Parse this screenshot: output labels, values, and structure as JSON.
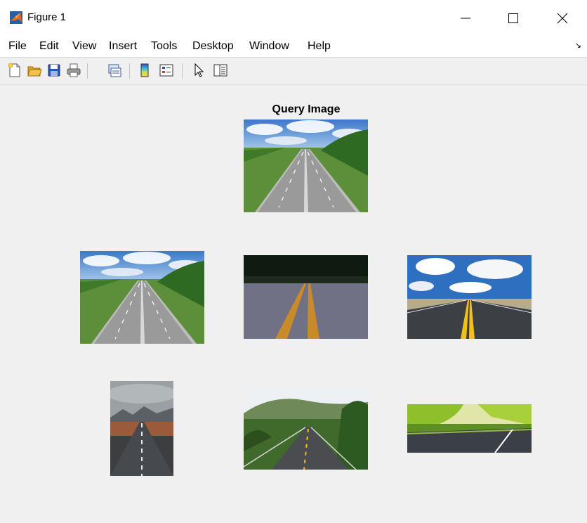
{
  "window": {
    "title": "Figure 1",
    "minimize_icon": "minimize-icon",
    "maximize_icon": "maximize-icon",
    "close_icon": "close-icon"
  },
  "menu": {
    "items": [
      "File",
      "Edit",
      "View",
      "Insert",
      "Tools",
      "Desktop",
      "Window",
      "Help"
    ]
  },
  "toolbar": {
    "icons": [
      "new-figure-icon",
      "open-file-icon",
      "save-icon",
      "print-icon",
      "link-plot-icon",
      "colorbar-icon",
      "legend-icon",
      "select-arrow-icon",
      "property-inspector-icon"
    ]
  },
  "figure": {
    "query_title": "Query Image",
    "images": [
      {
        "name": "query-image",
        "scene": "highway with grass and trees under cloudy blue sky"
      },
      {
        "name": "result-image-1",
        "scene": "highway with grass and trees under cloudy blue sky"
      },
      {
        "name": "result-image-2",
        "scene": "close-up asphalt road with yellow center lines"
      },
      {
        "name": "result-image-3",
        "scene": "desert road with yellow lines under cloudy blue sky"
      },
      {
        "name": "result-image-4",
        "scene": "road leading to misty mountains"
      },
      {
        "name": "result-image-5",
        "scene": "winding road through green hills"
      },
      {
        "name": "result-image-6",
        "scene": "road with bright green trees"
      }
    ]
  }
}
